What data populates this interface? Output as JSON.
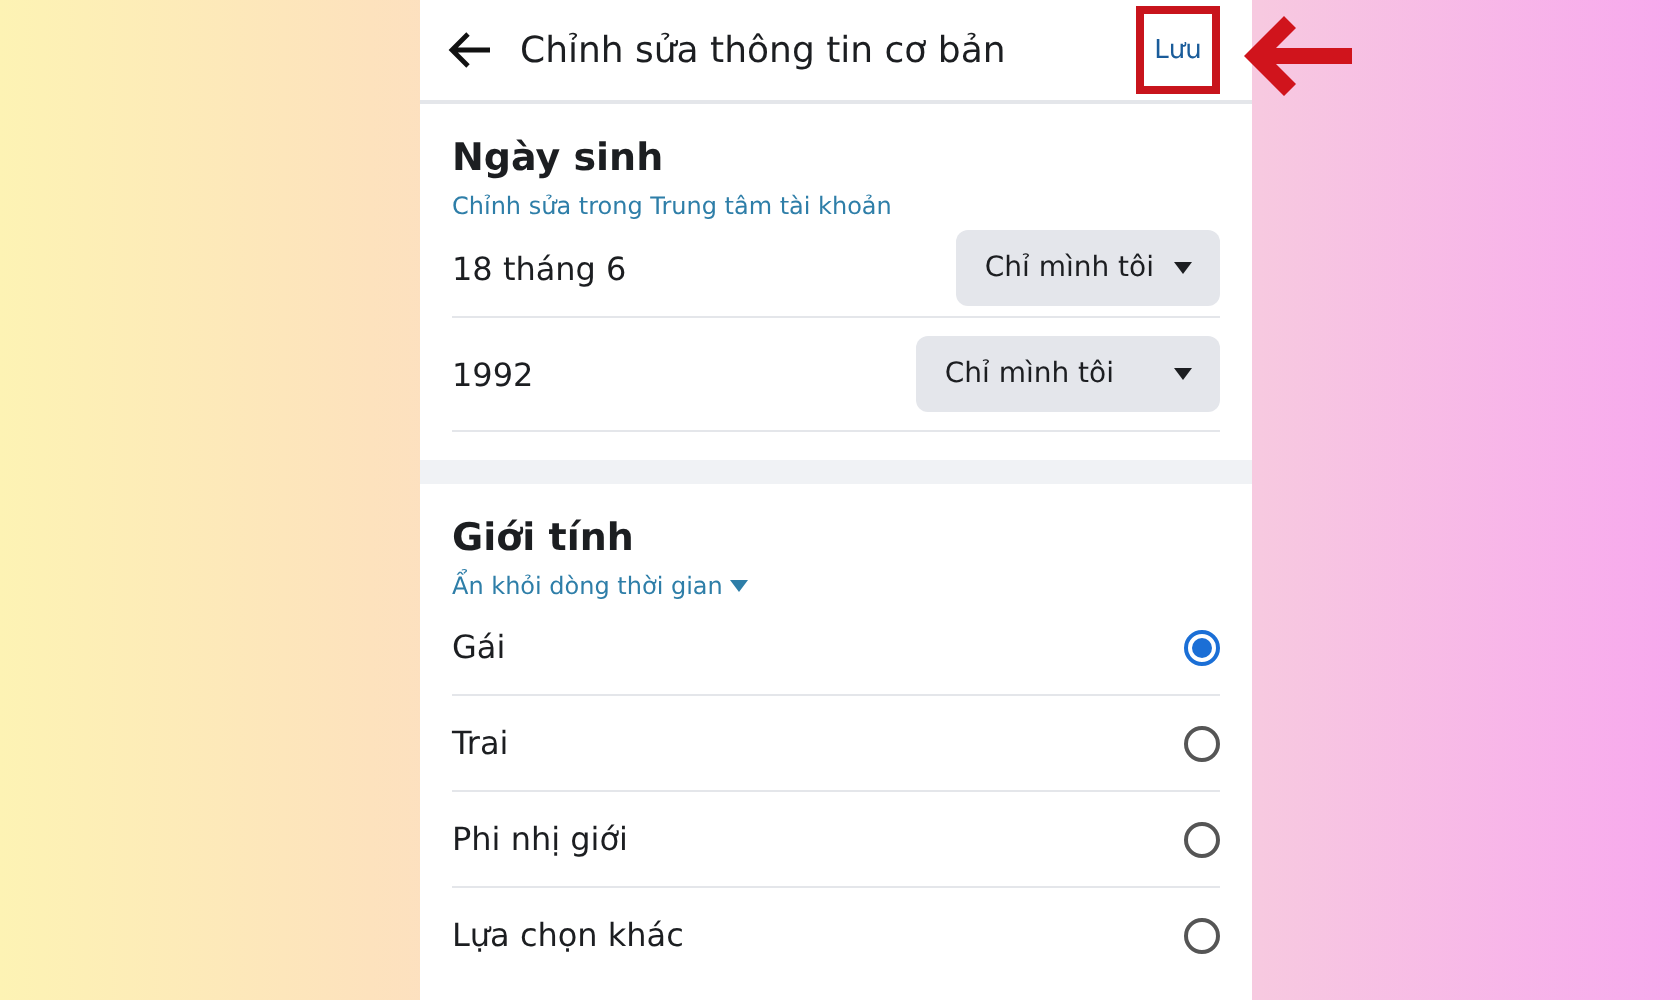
{
  "header": {
    "title": "Chỉnh sửa thông tin cơ bản",
    "save_button": {
      "label": "Lưu",
      "highlighted": true
    }
  },
  "birthday": {
    "title": "Ngày sinh",
    "link": "Chỉnh sửa trong Trung tâm tài khoản",
    "rows": [
      {
        "value": "18 tháng 6",
        "audience": "Chỉ mình tôi"
      },
      {
        "value": "1992",
        "audience": "Chỉ mình tôi"
      }
    ]
  },
  "gender": {
    "title": "Giới tính",
    "visibility": "Ẩn khỏi dòng thời gian",
    "options": [
      {
        "label": "Gái",
        "selected": true
      },
      {
        "label": "Trai",
        "selected": false
      },
      {
        "label": "Phi nhị giới",
        "selected": false
      },
      {
        "label": "Lựa chọn khác",
        "selected": false
      }
    ]
  }
}
